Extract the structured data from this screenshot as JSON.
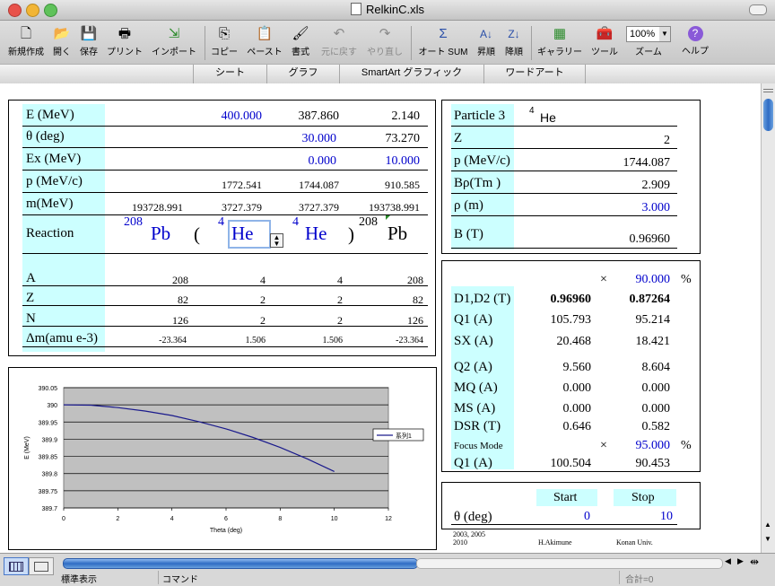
{
  "window": {
    "title": "RelkinC.xls"
  },
  "toolbar": {
    "new": "新規作成",
    "open": "開く",
    "save": "保存",
    "print": "プリント",
    "import": "インポート",
    "copy": "コピー",
    "paste": "ペースト",
    "format": "書式",
    "undo": "元に戻す",
    "redo": "やり直し",
    "autosum": "オート SUM",
    "sort_asc": "昇順",
    "sort_desc": "降順",
    "gallery": "ギャラリー",
    "tools": "ツール",
    "zoom_label": "ズーム",
    "zoom_value": "100%",
    "help": "ヘルプ"
  },
  "ribbon": {
    "tabs": [
      "シート",
      "グラフ",
      "SmartArt グラフィック",
      "ワードアート"
    ]
  },
  "kin": {
    "e_label": "E (MeV)",
    "e1": "400.000",
    "e2": "387.860",
    "e3": "2.140",
    "th_label": "θ (deg)",
    "th2": "30.000",
    "th3": "73.270",
    "ex_label": "Ex (MeV)",
    "ex2": "0.000",
    "ex3": "10.000",
    "p_label": "p (MeV/c)",
    "p1": "1772.541",
    "p2": "1744.087",
    "p3": "910.585",
    "m_label": "m(MeV)",
    "m0": "193728.991",
    "m1": "3727.379",
    "m2": "3727.379",
    "m3": "193738.991",
    "reaction_label": "Reaction",
    "r_a1": "208",
    "r_s1": "Pb",
    "r_paren_open": "(",
    "r_a2": "4",
    "r_s2": "He",
    "r_a3": "4",
    "r_s3": "He",
    "r_paren_close": ")",
    "r_a4": "208",
    "r_s4": "Pb",
    "a_label": "A",
    "a": [
      "208",
      "4",
      "4",
      "208"
    ],
    "z_label": "Z",
    "z": [
      "82",
      "2",
      "2",
      "82"
    ],
    "n_label": "N",
    "n": [
      "126",
      "2",
      "2",
      "126"
    ],
    "dm_label": "Δm(amu e-3)",
    "dm": [
      "-23.364",
      "1.506",
      "1.506",
      "-23.364"
    ]
  },
  "particle": {
    "label": "Particle 3",
    "mass": "4",
    "symbol": "He",
    "z_label": "Z",
    "z": "2",
    "p_label": "p (MeV/c)",
    "p": "1744.087",
    "brho_label": "Bρ(Tm )",
    "brho": "2.909",
    "rho_label": "ρ (m)",
    "rho": "3.000",
    "b_label": "B (T)",
    "b": "0.96960"
  },
  "magnets": {
    "times1": "×",
    "factor1": "90.000",
    "pct1": "%",
    "rows": [
      {
        "label": "D1,D2 (T)",
        "v1": "0.96960",
        "v2": "0.87264"
      },
      {
        "label": "Q1 (A)",
        "v1": "105.793",
        "v2": "95.214"
      },
      {
        "label": "SX (A)",
        "v1": "20.468",
        "v2": "18.421"
      },
      {
        "label": "Q2 (A)",
        "v1": "9.560",
        "v2": "8.604"
      },
      {
        "label": "MQ (A)",
        "v1": "0.000",
        "v2": "0.000"
      },
      {
        "label": "MS (A)",
        "v1": "0.000",
        "v2": "0.000"
      },
      {
        "label": "DSR (T)",
        "v1": "0.646",
        "v2": "0.582"
      }
    ],
    "focus_label": "Focus Mode",
    "times2": "×",
    "factor2": "95.000",
    "pct2": "%",
    "q1f_label": "Q1 (A)",
    "q1f_v1": "100.504",
    "q1f_v2": "90.453"
  },
  "range": {
    "start_label": "Start",
    "stop_label": "Stop",
    "theta_label": "θ (deg)",
    "start": "0",
    "stop": "10"
  },
  "footer": {
    "years": "2003, 2005",
    "year2": "2010",
    "author": "H.Akimune",
    "univ": "Konan Univ."
  },
  "status": {
    "mode": "標準表示",
    "command": "コマンド",
    "sum": "合計=0"
  },
  "colors": {
    "cyan": "#ccffff",
    "input_blue": "#0000cc",
    "series": "#1a1a8c",
    "plot_bg": "#c0c0c0"
  },
  "chart_data": {
    "type": "line",
    "xlabel": "Theta (deg)",
    "ylabel": "E (MeV)",
    "xlim": [
      0,
      12
    ],
    "ylim": [
      389.7,
      390.05
    ],
    "xticks": [
      "0",
      "2",
      "4",
      "6",
      "8",
      "10",
      "12"
    ],
    "yticks": [
      "389.7",
      "389.75",
      "389.8",
      "389.85",
      "389.9",
      "389.95",
      "390",
      "390.05"
    ],
    "grid": true,
    "legend_position": "right",
    "series": [
      {
        "name": "系列1",
        "x": [
          0,
          1,
          2,
          3,
          4,
          5,
          6,
          7,
          8,
          9,
          10
        ],
        "y": [
          390.0,
          389.999,
          389.992,
          389.982,
          389.969,
          389.951,
          389.93,
          389.905,
          389.876,
          389.843,
          389.806
        ]
      }
    ]
  }
}
